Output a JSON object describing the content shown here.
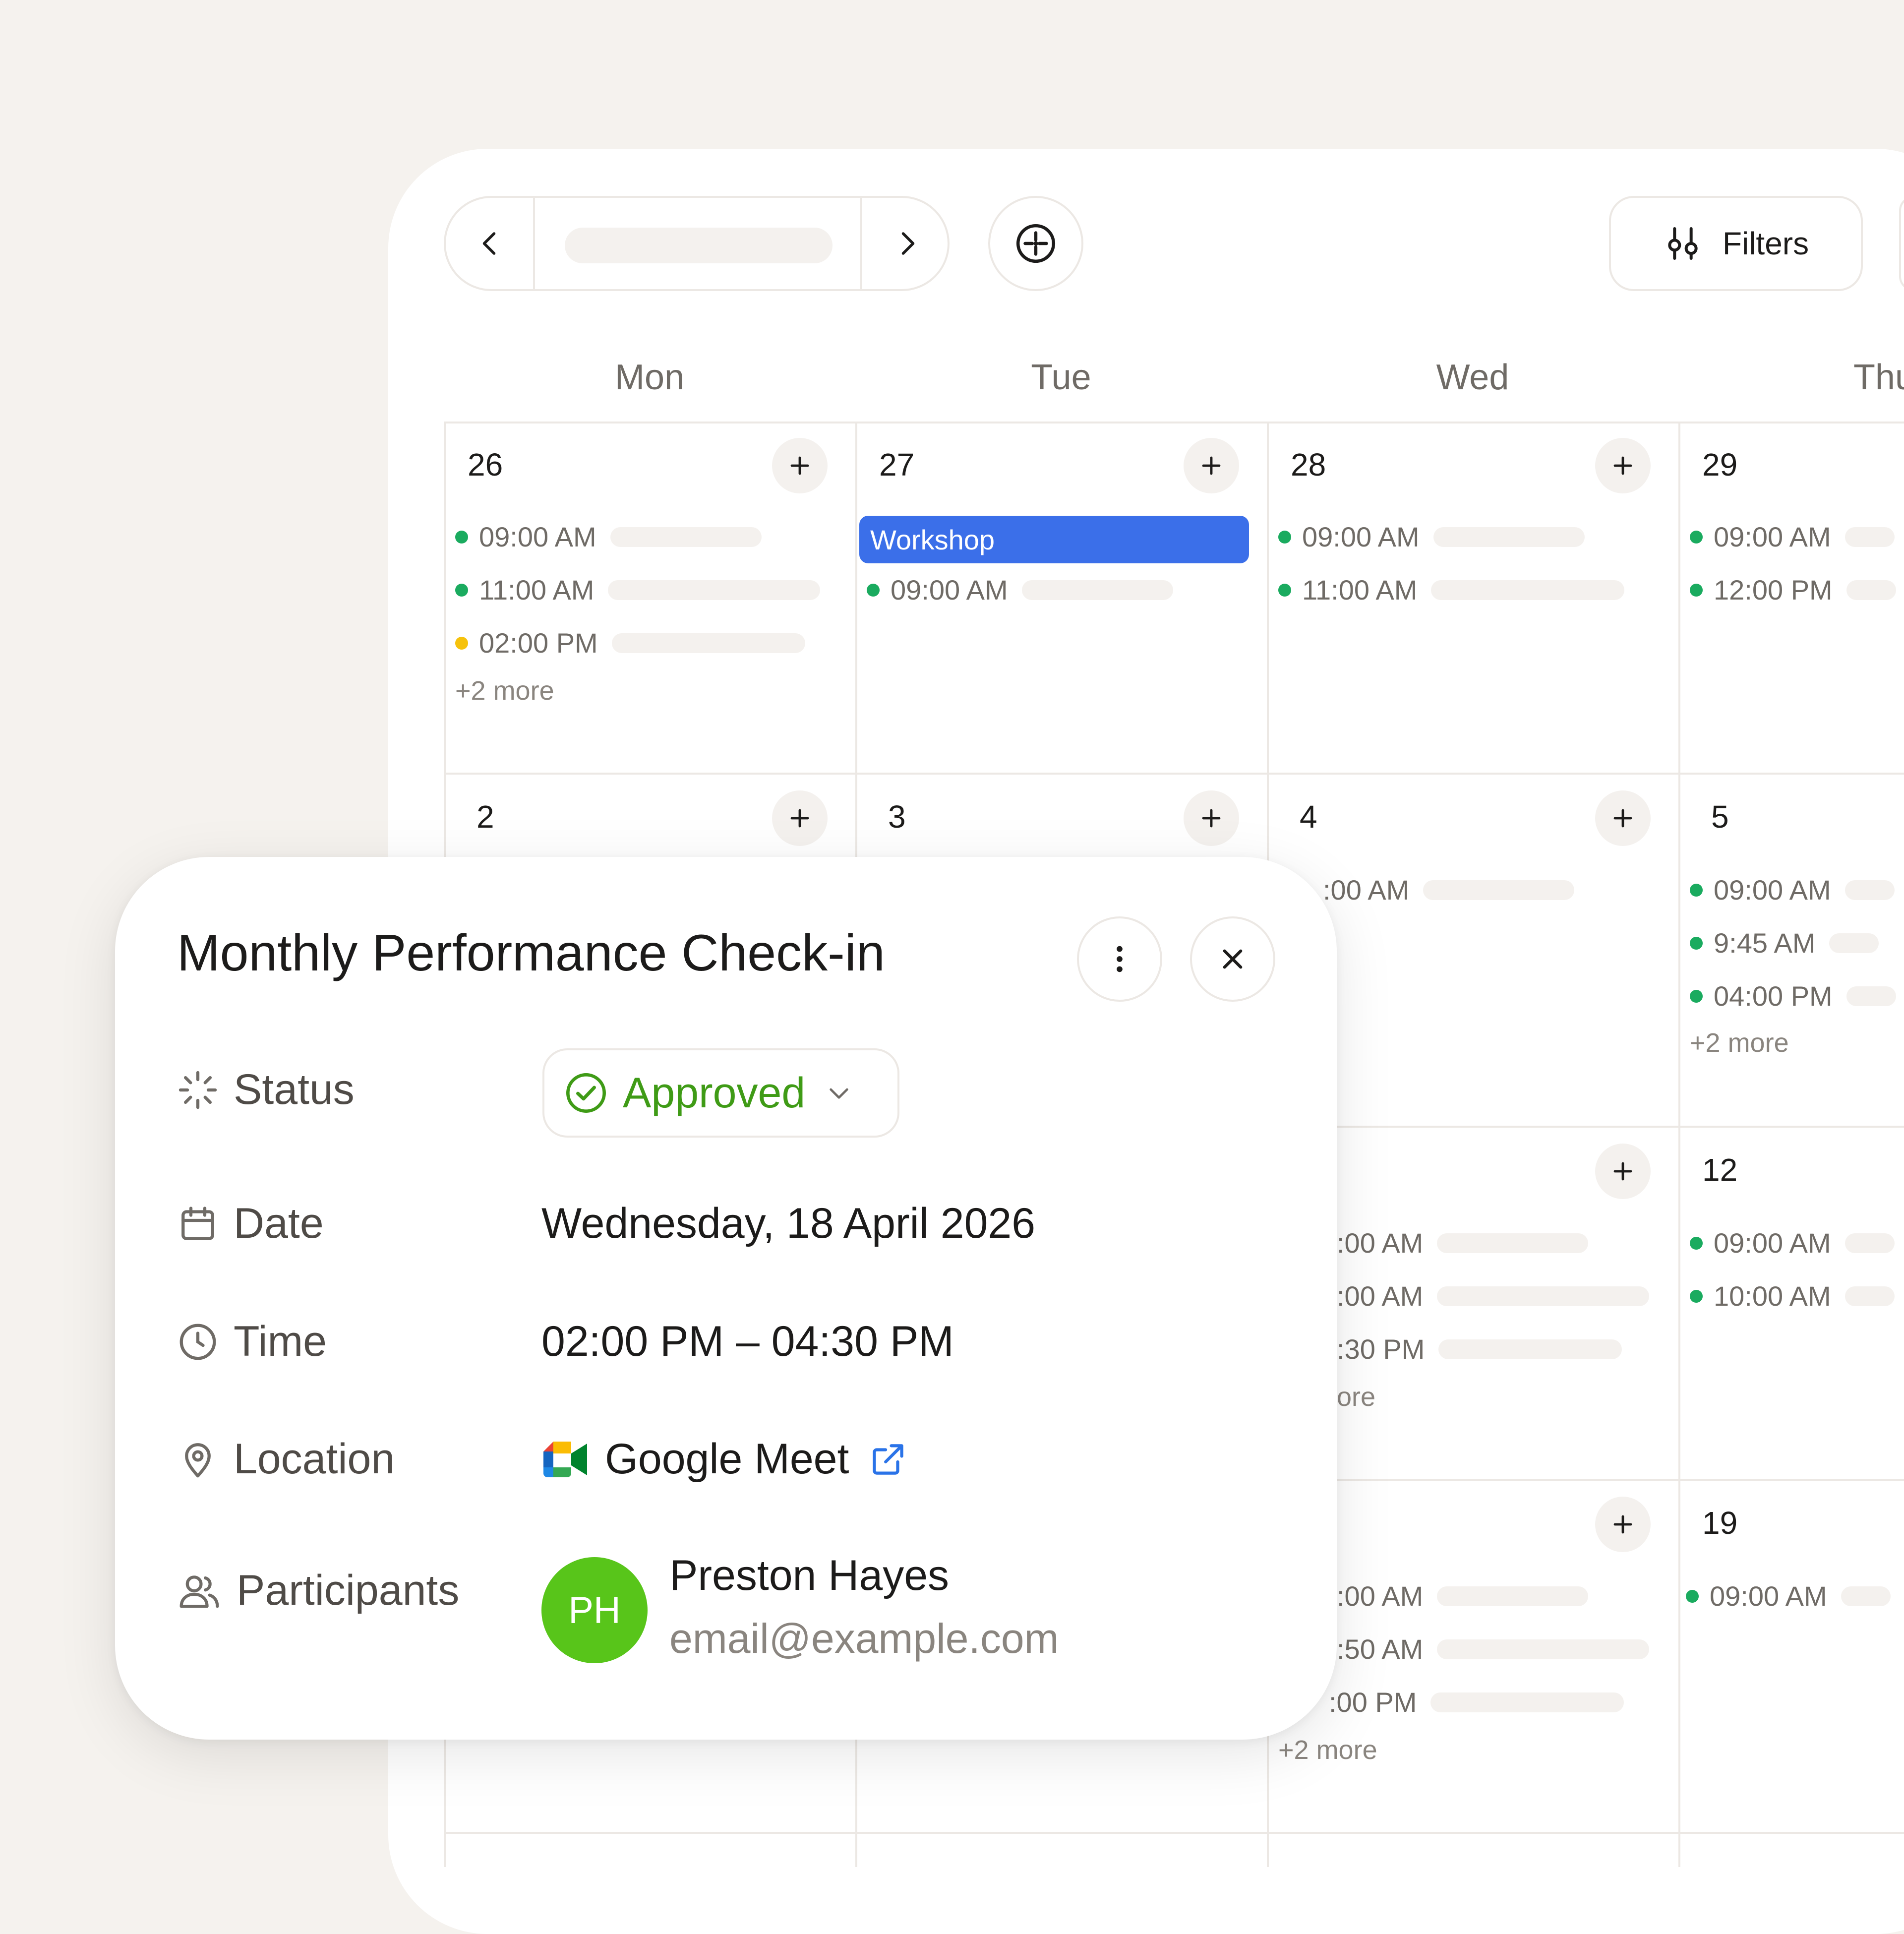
{
  "toolbar": {
    "prev_icon": "chevron-left-icon",
    "next_icon": "chevron-right-icon",
    "today_icon": "target-icon",
    "filters_label": "Filters",
    "filters_icon": "sliders-icon"
  },
  "days": [
    "Mon",
    "Tue",
    "Wed",
    "Thu"
  ],
  "calendar": {
    "dates": [
      "26",
      "27",
      "28",
      "29",
      "2",
      "3",
      "4",
      "5",
      "12",
      "19"
    ],
    "events": {
      "mon26": [
        "09:00 AM",
        "11:00 AM",
        "02:00 PM"
      ],
      "mon26_more": "+2 more",
      "tue27_banner": "Workshop",
      "tue27": [
        "09:00 AM"
      ],
      "wed28": [
        "09:00 AM",
        "11:00 AM"
      ],
      "thu29": [
        "09:00 AM",
        "12:00 PM"
      ],
      "wed4": [
        ":00 AM"
      ],
      "thu5": [
        "09:00 AM",
        "9:45 AM",
        "04:00 PM"
      ],
      "thu5_more": "+2 more",
      "wed11": [
        ":00 AM",
        ":00 AM",
        ":30 PM"
      ],
      "wed11_more": "ore",
      "thu12": [
        "09:00 AM",
        "10:00 AM"
      ],
      "wed18": [
        ":00 AM",
        ":50 AM",
        ":00 PM"
      ],
      "wed18_more": "+2 more",
      "thu19": [
        "09:00 AM"
      ]
    },
    "colors": {
      "green": "#1aab5f",
      "yellow": "#f6c20c",
      "blue": "#3b6fe9"
    }
  },
  "popup": {
    "title": "Monthly Performance Check-in",
    "labels": {
      "status": "Status",
      "date": "Date",
      "time": "Time",
      "location": "Location",
      "participants": "Participants"
    },
    "status_value": "Approved",
    "date_value": "Wednesday, 18 April 2026",
    "time_value": "02:00 PM – 04:30 PM",
    "location_value": "Google Meet",
    "participant": {
      "initials": "PH",
      "name": "Preston Hayes",
      "email": "email@example.com"
    },
    "status_color": "#3f9b16",
    "avatar_color": "#58c51a"
  }
}
